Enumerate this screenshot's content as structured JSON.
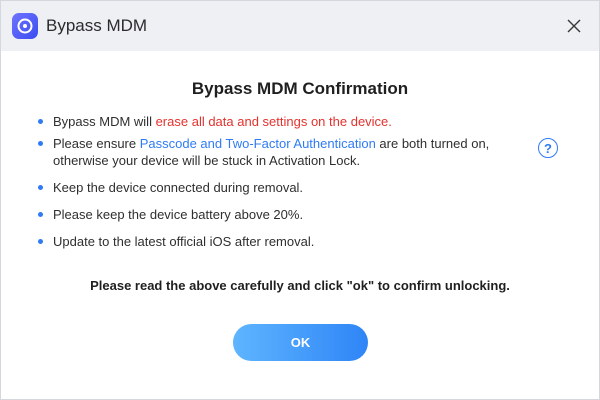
{
  "window": {
    "title": "Bypass MDM",
    "app_icon": "disc-icon",
    "close_icon": "close-icon"
  },
  "dialog": {
    "heading": "Bypass MDM Confirmation",
    "items": [
      {
        "before": "Bypass MDM will ",
        "highlight": "erase all data and settings on the device.",
        "after": ""
      },
      {
        "before": "Please ensure ",
        "highlight": "Passcode and Two-Factor Authentication",
        "after": " are both turned on, otherwise your device will be stuck in Activation Lock."
      },
      {
        "text": "Keep the device connected during removal."
      },
      {
        "text": "Please keep the device battery above 20%."
      },
      {
        "text": "Update to the latest official iOS after removal."
      }
    ],
    "help_symbol": "?",
    "notice": "Please read the above carefully and click \"ok\" to confirm unlocking.",
    "ok_label": "OK"
  },
  "colors": {
    "accent": "#2f7bf6",
    "warning": "#e5322d",
    "titlebar_bg": "#eef0f3"
  }
}
